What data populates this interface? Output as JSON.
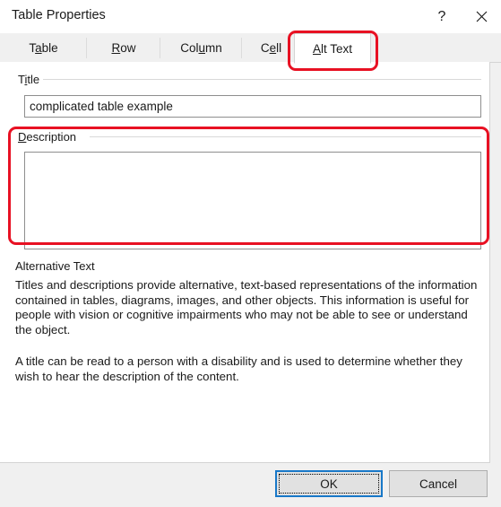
{
  "window": {
    "title": "Table Properties",
    "help_icon": "question-mark-icon",
    "close_icon": "close-x-icon"
  },
  "tabs": [
    {
      "id": "table",
      "label_pre": "T",
      "label_key": "a",
      "label_post": "ble",
      "active": false
    },
    {
      "id": "row",
      "label_pre": "",
      "label_key": "R",
      "label_post": "ow",
      "active": false
    },
    {
      "id": "column",
      "label_pre": "Col",
      "label_key": "u",
      "label_post": "mn",
      "active": false
    },
    {
      "id": "cell",
      "label_pre": "C",
      "label_key": "e",
      "label_post": "ll",
      "active": false
    },
    {
      "id": "alt-text",
      "label_pre": "",
      "label_key": "A",
      "label_post": "lt Text",
      "active": true
    }
  ],
  "title_group": {
    "label_pre": "T",
    "label_key": "i",
    "label_post": "tle",
    "value": "complicated table example",
    "placeholder": ""
  },
  "description_group": {
    "label_pre": "",
    "label_key": "D",
    "label_post": "escription",
    "value": "",
    "placeholder": ""
  },
  "help": {
    "heading": "Alternative Text",
    "paragraph1": "Titles and descriptions provide alternative, text-based representations of the information contained in tables, diagrams, images, and other objects. This information is useful for people with vision or cognitive impairments who may not be able to see or understand the object.",
    "paragraph2": "A title can be read to a person with a disability and is used to determine whether they wish to hear the description of the content."
  },
  "footer": {
    "ok_label": "OK",
    "cancel_label": "Cancel"
  },
  "annotations": {
    "accent_color": "#e81123",
    "targets": [
      "alt-text-tab",
      "description-group"
    ]
  }
}
